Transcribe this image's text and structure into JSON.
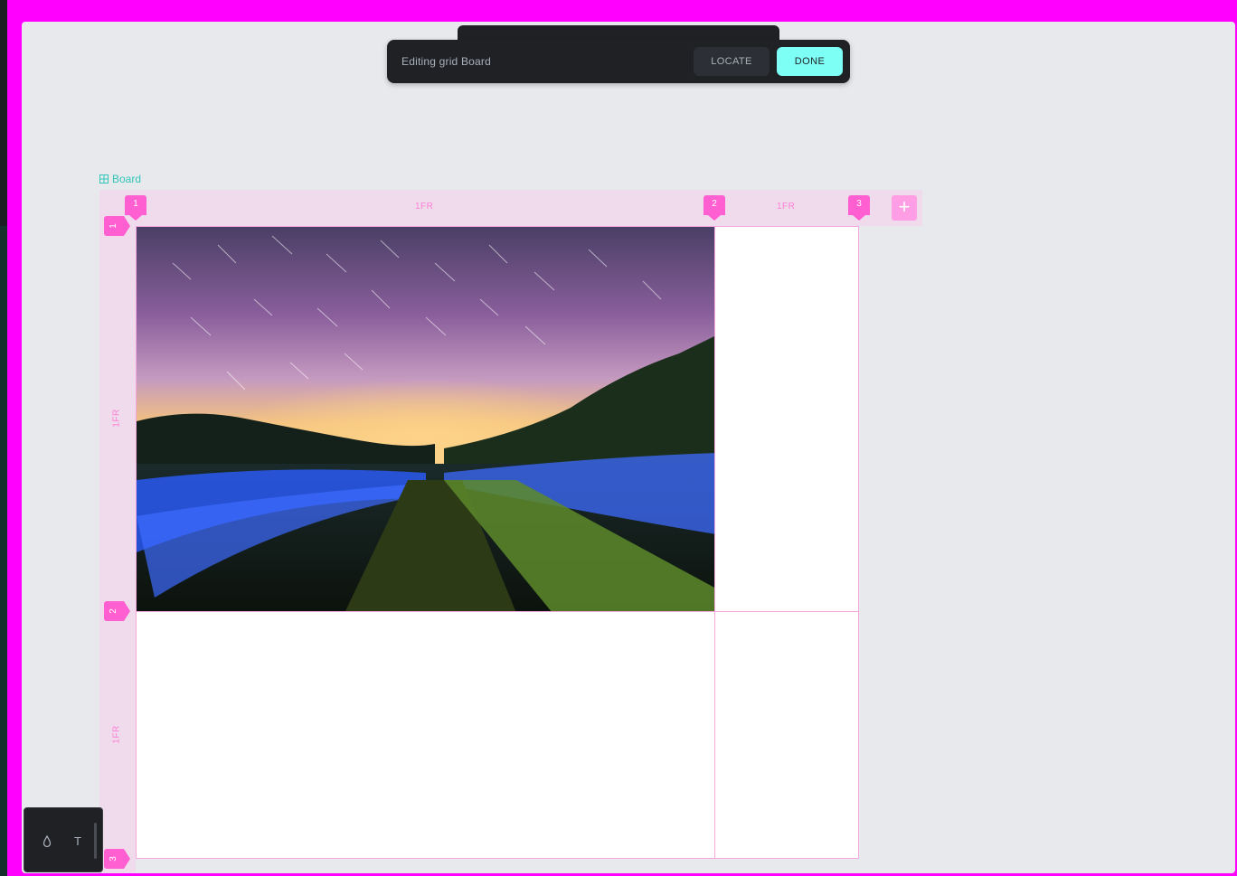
{
  "toolbar": {
    "title": "Editing grid Board",
    "locate_label": "LOCATE",
    "done_label": "DONE"
  },
  "board": {
    "name": "Board"
  },
  "grid": {
    "columns": [
      {
        "marker": "1",
        "size": "1FR"
      },
      {
        "marker": "2",
        "size": "1FR"
      },
      {
        "marker": "3"
      }
    ],
    "rows": [
      {
        "marker": "1",
        "size": "1FR"
      },
      {
        "marker": "2",
        "size": "1FR"
      },
      {
        "marker": "3"
      }
    ],
    "add_label": "+"
  },
  "tools": {
    "drop_icon": "drop-icon",
    "text_icon_label": "T"
  },
  "colors": {
    "accent_pink": "#ff5fd0",
    "done_cyan": "#7dfff5",
    "board_teal": "#31c6b8"
  }
}
